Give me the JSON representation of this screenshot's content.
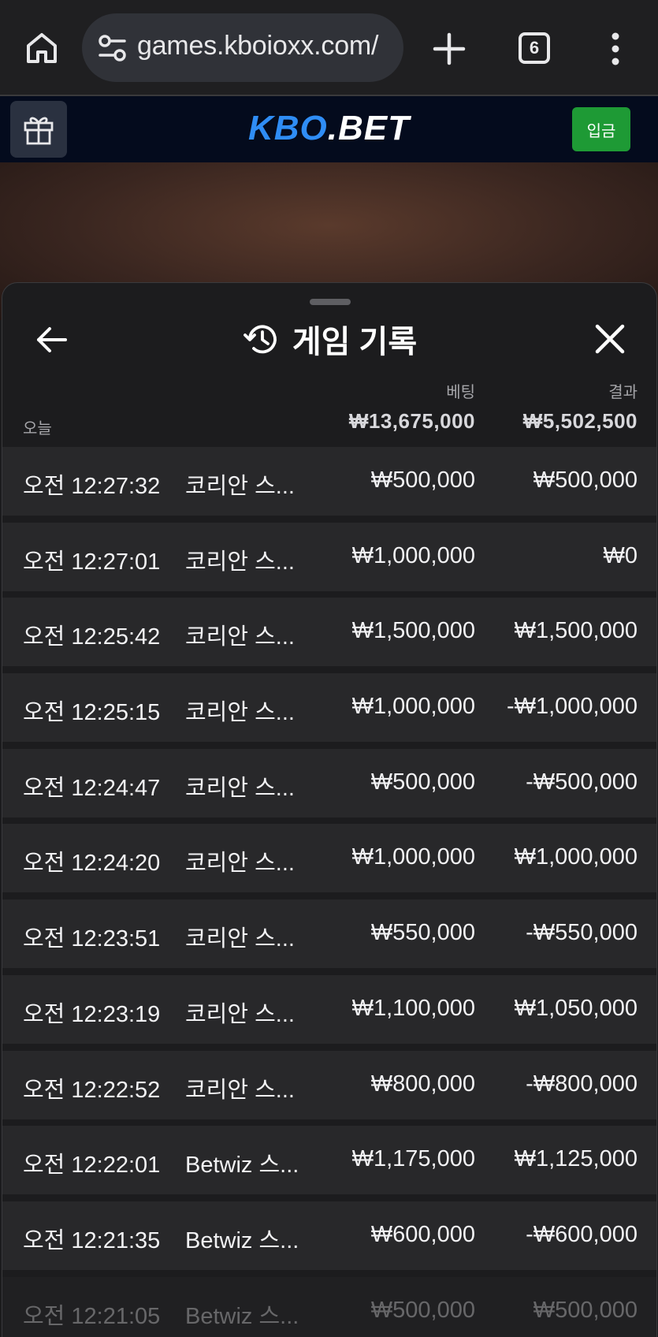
{
  "browser": {
    "url": "games.kboioxx.com/",
    "tab_count": "6"
  },
  "site": {
    "logo_kbo": "KBO",
    "logo_dot": ".",
    "logo_bet": "BET",
    "deposit_label": "입금"
  },
  "sheet": {
    "title": "게임 기록",
    "summary": {
      "bet_label": "베팅",
      "result_label": "결과",
      "today_label": "오늘",
      "bet_total": "₩13,675,000",
      "result_total": "₩5,502,500"
    },
    "rows": [
      {
        "time": "오전 12:27:32",
        "game": "코리안 스...",
        "bet": "₩500,000",
        "result": "₩500,000"
      },
      {
        "time": "오전 12:27:01",
        "game": "코리안 스...",
        "bet": "₩1,000,000",
        "result": "₩0"
      },
      {
        "time": "오전 12:25:42",
        "game": "코리안 스...",
        "bet": "₩1,500,000",
        "result": "₩1,500,000"
      },
      {
        "time": "오전 12:25:15",
        "game": "코리안 스...",
        "bet": "₩1,000,000",
        "result": "-₩1,000,000"
      },
      {
        "time": "오전 12:24:47",
        "game": "코리안 스...",
        "bet": "₩500,000",
        "result": "-₩500,000"
      },
      {
        "time": "오전 12:24:20",
        "game": "코리안 스...",
        "bet": "₩1,000,000",
        "result": "₩1,000,000"
      },
      {
        "time": "오전 12:23:51",
        "game": "코리안 스...",
        "bet": "₩550,000",
        "result": "-₩550,000"
      },
      {
        "time": "오전 12:23:19",
        "game": "코리안 스...",
        "bet": "₩1,100,000",
        "result": "₩1,050,000"
      },
      {
        "time": "오전 12:22:52",
        "game": "코리안 스...",
        "bet": "₩800,000",
        "result": "-₩800,000"
      },
      {
        "time": "오전 12:22:01",
        "game": "Betwiz 스...",
        "bet": "₩1,175,000",
        "result": "₩1,125,000"
      },
      {
        "time": "오전 12:21:35",
        "game": "Betwiz 스...",
        "bet": "₩600,000",
        "result": "-₩600,000"
      },
      {
        "time": "오전 12:21:05",
        "game": "Betwiz 스...",
        "bet": "₩500,000",
        "result": "₩500,000"
      }
    ]
  },
  "icons": {
    "home": "home-icon",
    "site_settings": "tune-icon",
    "new_tab": "plus-icon",
    "tabs": "tab-count-icon",
    "menu": "more-vert-icon",
    "gift": "gift-icon",
    "back": "arrow-left-icon",
    "history": "history-icon",
    "close": "close-icon"
  },
  "colors": {
    "browser_bg": "#1f1f21",
    "site_header_bg": "#040b1d",
    "logo_blue": "#2f8df5",
    "deposit_green": "#1e9a35",
    "sheet_bg": "#1c1c1e",
    "row_bg": "#28282a"
  }
}
